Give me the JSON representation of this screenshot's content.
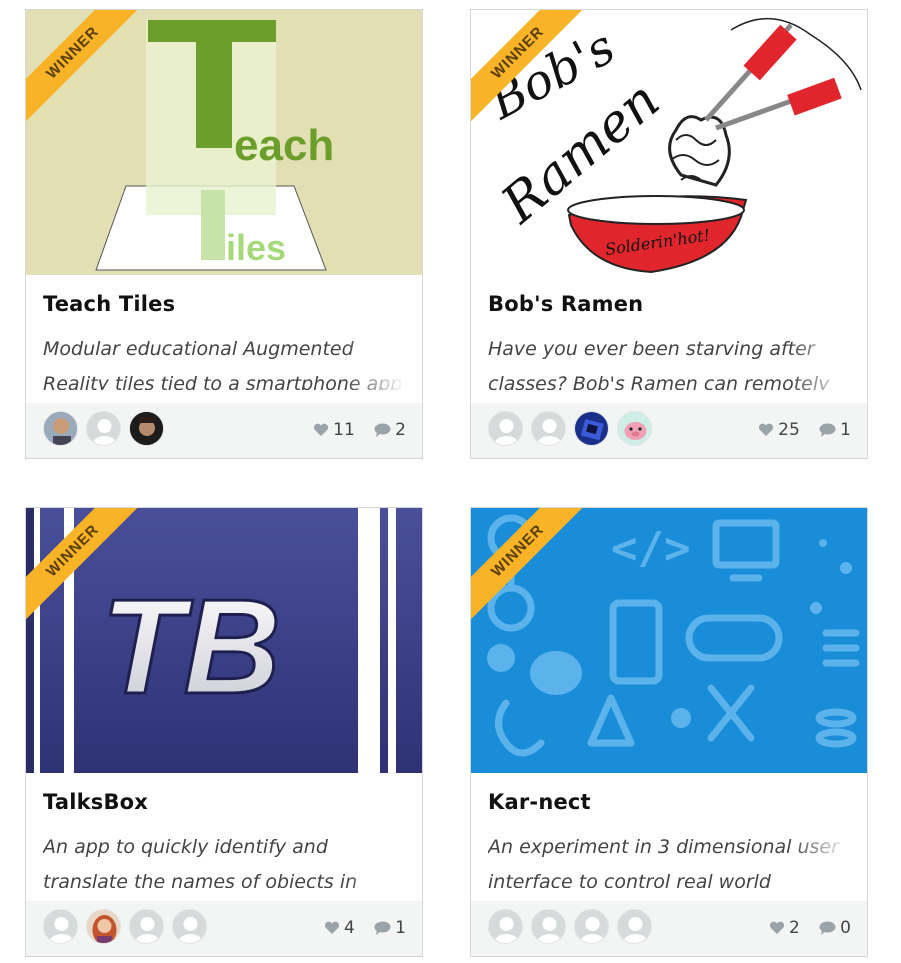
{
  "ribbon_label": "WINNER",
  "colors": {
    "ribbon": "#f9b327",
    "footer_bg": "#f3f5f5",
    "card_border": "#d5d8d8"
  },
  "cards": [
    {
      "title": "Teach Tiles",
      "description": "Modular educational Augmented Reality tiles tied to a smartphone app",
      "likes": "11",
      "comments": "2",
      "thumb_text": {
        "big": "T",
        "line1": "each",
        "line2": "iles"
      },
      "avatars": [
        "photo-person-beard",
        "default-avatar",
        "photo-person-dark"
      ]
    },
    {
      "title": "Bob's Ramen",
      "description": "Have you ever been starving after classes? Bob's Ramen can remotely",
      "likes": "25",
      "comments": "1",
      "thumb_text": {
        "line1": "Bob's",
        "line2": "Ramen",
        "bowl": "Solderin'hot!"
      },
      "avatars": [
        "default-avatar",
        "default-avatar",
        "photo-blue-device",
        "photo-cartoon-pig"
      ]
    },
    {
      "title": "TalksBox",
      "description": "An app to quickly identify and translate the names of objects in your",
      "likes": "4",
      "comments": "1",
      "thumb_text": {
        "logo": "TB"
      },
      "avatars": [
        "default-avatar",
        "photo-person-red-hair",
        "default-avatar",
        "default-avatar"
      ]
    },
    {
      "title": "Kar-nect",
      "description": "An experiment in 3 dimensional user interface to control real world",
      "likes": "2",
      "comments": "0",
      "thumb_text": {
        "code": "</>"
      },
      "avatars": [
        "default-avatar",
        "default-avatar",
        "default-avatar",
        "default-avatar"
      ]
    }
  ]
}
